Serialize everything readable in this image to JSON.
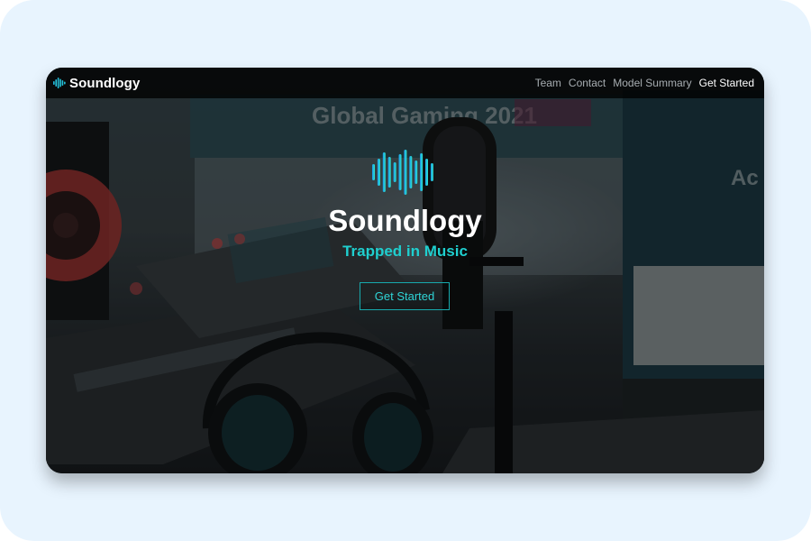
{
  "nav": {
    "brand_name": "Soundlogy",
    "brand_icon": "sound-wave-icon",
    "links": [
      {
        "label": "Team"
      },
      {
        "label": "Contact"
      },
      {
        "label": "Model Summary"
      },
      {
        "label": "Get Started"
      }
    ]
  },
  "hero": {
    "logo_icon": "sound-wave-icon",
    "title": "Soundlogy",
    "tagline": "Trapped in Music",
    "button_label": "Get Started"
  },
  "background": {
    "banner_text": "Global Gaming 2021",
    "screen_text": "Ac Gl"
  },
  "colors": {
    "accent": "#1fcfcf",
    "accent_gradient_start": "#1a9cf0",
    "accent_gradient_end": "#2ee6c8",
    "frame_background": "#e8f4fe",
    "navbar_background": "#0d0f10"
  }
}
